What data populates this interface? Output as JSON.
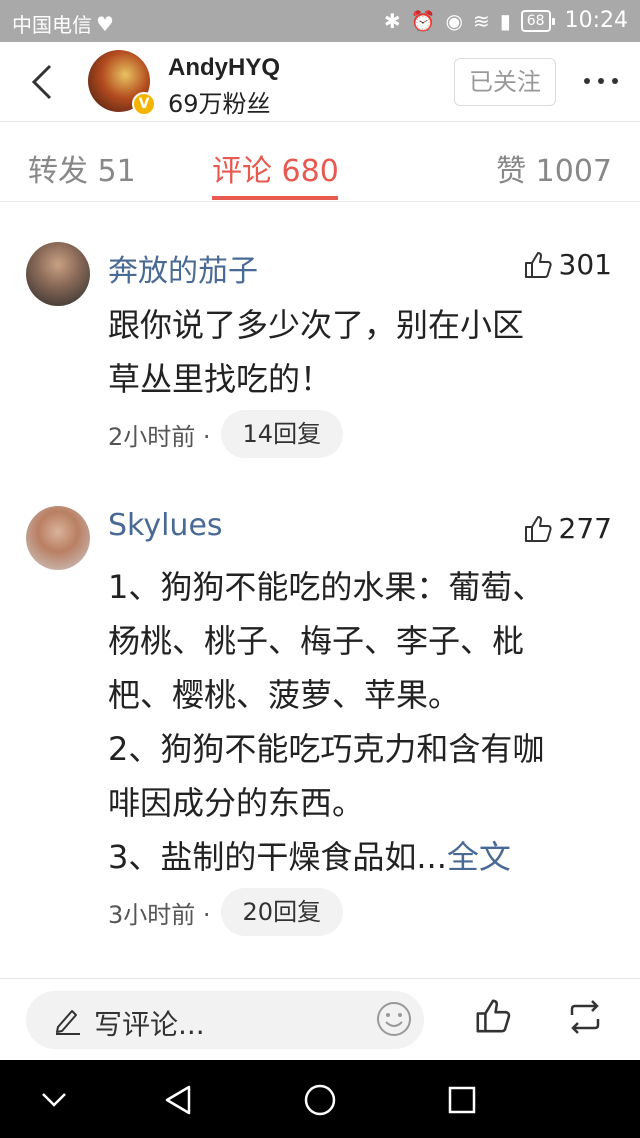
{
  "status_bar": {
    "carrier": "中国电信",
    "battery": "68",
    "time": "10:24"
  },
  "header": {
    "user_name": "AndyHYQ",
    "fans": "69万粉丝",
    "follow_label": "已关注"
  },
  "tabs": {
    "repost": "转发 51",
    "comment": "评论 680",
    "like": "赞 1007",
    "active": "comment"
  },
  "comments": [
    {
      "name": "奔放的茄子",
      "likes": "301",
      "lines": [
        "跟你说了多少次了，别在小区",
        "草丛里找吃的！"
      ],
      "time": "2小时前 ·",
      "replies": "14回复"
    },
    {
      "name": "Skylues",
      "likes": "277",
      "lines": [
        "1、狗狗不能吃的水果：葡萄、",
        "杨桃、桃子、梅子、李子、枇",
        "杷、樱桃、菠萝、苹果。",
        "2、狗狗不能吃巧克力和含有咖",
        "啡因成分的东西。",
        "3、盐制的干燥食品如..."
      ],
      "full_text": "全文",
      "time": "3小时前 ·",
      "replies": "20回复"
    }
  ],
  "bottom_bar": {
    "placeholder": "写评论..."
  },
  "colors": {
    "accent": "#e8594f",
    "link": "#4a6a96",
    "status_bar": "#a9a9a9"
  }
}
